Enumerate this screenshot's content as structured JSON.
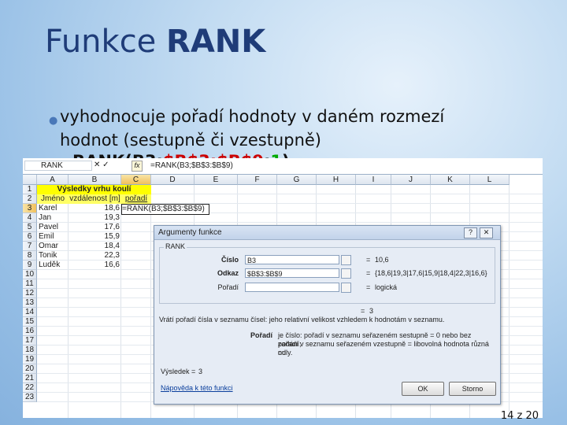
{
  "slide": {
    "title_normal": "Funkce ",
    "title_bold": "RANK",
    "bullet_line1": "vyhodnocuje pořadí hodnoty v daném rozmezí",
    "bullet_line2": "hodnot (sestupně či vzestupně)",
    "formula_a": "RANK(B3;",
    "formula_b": "$B$3:$B$9",
    "formula_c": ";",
    "formula_d": "1",
    "formula_e": ")",
    "page_number": "14 z 20"
  },
  "excel": {
    "name_box": "RANK",
    "formula_buttons": "✕ ✓",
    "fx_label": "fx",
    "formula_text": "=RANK(B3;$B$3:$B$9)",
    "columns": [
      "A",
      "B",
      "C",
      "D",
      "E",
      "F",
      "G",
      "H",
      "I",
      "J",
      "K",
      "L"
    ],
    "rows": [
      "1",
      "2",
      "3",
      "4",
      "5",
      "6",
      "7",
      "8",
      "9",
      "10",
      "11",
      "12",
      "13",
      "14",
      "15",
      "16",
      "17",
      "18",
      "19",
      "20",
      "21",
      "22",
      "23"
    ],
    "table_title": "Výsledky vrhu koulí",
    "headers": [
      "Jméno",
      "vzdálenost [m]",
      "pořadí"
    ],
    "names": [
      "Karel",
      "Jan",
      "Pavel",
      "Emil",
      "Omar",
      "Tonik",
      "Luděk"
    ],
    "values": [
      "18,6",
      "19,3",
      "17,6",
      "15,9",
      "18,4",
      "22,3",
      "16,6"
    ],
    "edit_text": "=RANK(B3;$B$3:$B$9)"
  },
  "dialog": {
    "title": "Argumenty funkce",
    "help_btn": "?",
    "close_btn": "✕",
    "group_label": "RANK",
    "args": [
      {
        "label": "Číslo",
        "value": "B3",
        "result": "10,6"
      },
      {
        "label": "Odkaz",
        "value": "$B$3:$B$9",
        "result": "{18,6|19,3|17,6|15,9|18,4|22,3|16,6}"
      },
      {
        "label": "Pořadí",
        "value": "",
        "result": "logická"
      }
    ],
    "eq": "=",
    "total_result": "3",
    "description": "Vrátí pořadí čísla v seznamu čísel: jeho relativní velikost vzhledem k hodnotám v seznamu.",
    "param_name": "Pořadí",
    "param_desc_1": "je číslo: pořadí v seznamu seřazeném sestupně = 0 nebo bez zadání;",
    "param_desc_2": "pořadí v seznamu seřazeném vzestupně = libovolná hodnota různá od",
    "param_desc_3": "nuly.",
    "result_label": "Výsledek =",
    "result_value": "3",
    "help_link": "Nápověda k této funkci",
    "ok": "OK",
    "cancel": "Storno"
  }
}
